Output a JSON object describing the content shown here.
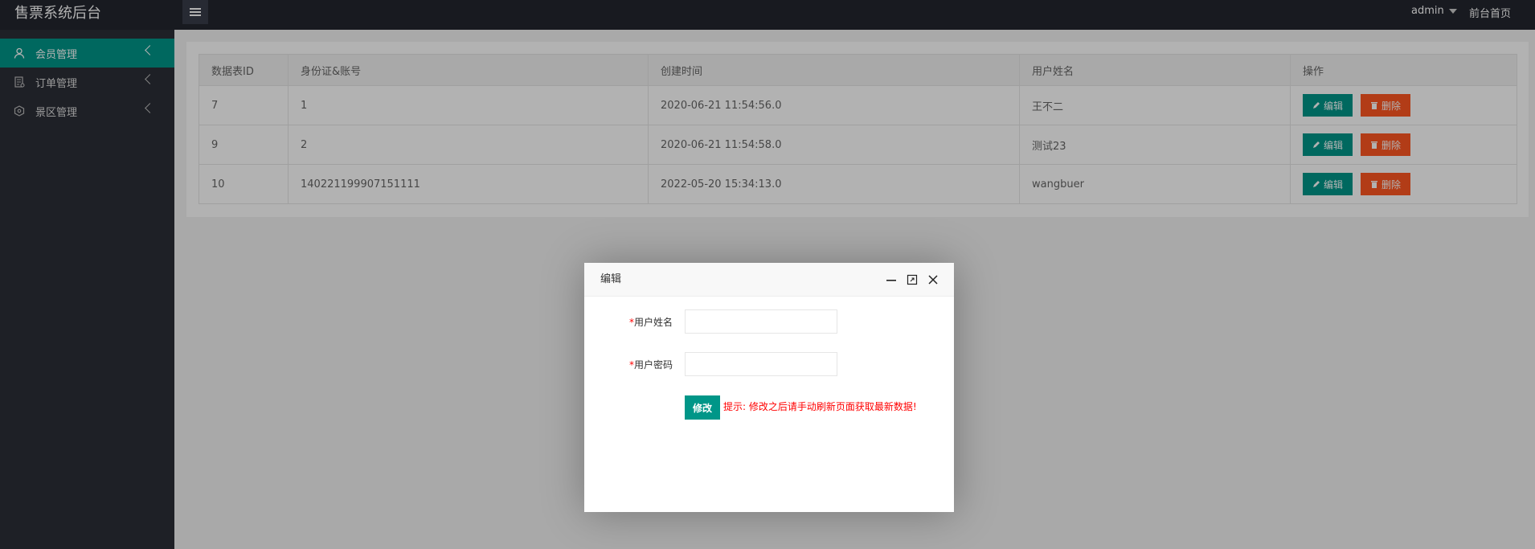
{
  "header": {
    "title": "售票系统后台",
    "user": "admin",
    "front_link": "前台首页"
  },
  "sidebar": {
    "items": [
      {
        "label": "会员管理",
        "active": true
      },
      {
        "label": "订单管理"
      },
      {
        "label": "景区管理"
      }
    ]
  },
  "table": {
    "headers": [
      "数据表ID",
      "身份证&账号",
      "创建时间",
      "用户姓名",
      "操作"
    ],
    "rows": [
      {
        "id": "7",
        "account": "1",
        "created": "2020-06-21 11:54:56.0",
        "name": "王不二"
      },
      {
        "id": "9",
        "account": "2",
        "created": "2020-06-21 11:54:58.0",
        "name": "测试23"
      },
      {
        "id": "10",
        "account": "140221199907151111",
        "created": "2022-05-20 15:34:13.0",
        "name": "wangbuer"
      }
    ],
    "edit_label": "编辑",
    "delete_label": "删除"
  },
  "dialog": {
    "title": "编辑",
    "fields": [
      {
        "required_mark": "*",
        "label": "用户姓名",
        "value": ""
      },
      {
        "required_mark": "*",
        "label": "用户密码",
        "value": ""
      }
    ],
    "submit_label": "修改",
    "hint": "提示: 修改之后请手动刷新页面获取最新数据!"
  },
  "colors": {
    "primary": "#009688",
    "danger": "#ff5722",
    "header_bg": "#23262e",
    "sidebar_bg": "#2b2e37"
  }
}
